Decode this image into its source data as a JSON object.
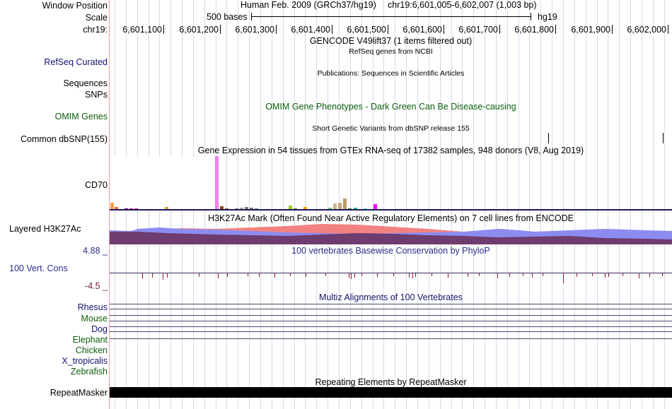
{
  "header": {
    "assembly": "Human Feb. 2009 (GRCh37/hg19)",
    "position": "chr19:6,601,005-6,602,007 (1,003 bp)",
    "scale_label": "500 bases",
    "scale_db": "hg19",
    "chrom_label": "chr19:",
    "ticks": [
      "6,601,100",
      "6,601,200",
      "6,601,300",
      "6,601,400",
      "6,601,500",
      "6,601,600",
      "6,601,700",
      "6,601,800",
      "6,601,900",
      "6,602,000"
    ]
  },
  "labels": {
    "window_position": "Window Position",
    "scale": "Scale",
    "refseq": "RefSeq Curated",
    "sequences": "Sequences",
    "snps": "SNPs",
    "omim": "OMIM Genes",
    "dbsnp": "Common dbSNP(155)",
    "cd70": "CD70",
    "h3k27ac": "Layered H3K27Ac",
    "cons_max": "4.88 _",
    "cons": "100 Vert. Cons",
    "cons_min": "-4.5 _",
    "species": [
      "Rhesus",
      "Mouse",
      "Dog",
      "Elephant",
      "Chicken",
      "X_tropicalis",
      "Zebrafish"
    ],
    "repeatmasker": "RepeatMasker"
  },
  "tracks": {
    "gencode": "GENCODE V49lift37 (1 items filtered out)",
    "refseq": "RefSeq genes from NCBI",
    "publications": "Publications: Sequences in Scientific Articles",
    "omim": "OMIM Gene Phenotypes - Dark Green Can Be Disease-causing",
    "dbsnp": "Short Genetic Variants from dbSNP release 155",
    "gtex": "Gene Expression in 54 tissues from GTEx RNA-seq of 17382 samples, 948 donors (V8, Aug 2019)",
    "h3k27ac": "H3K27Ac Mark (Often Found Near Active Regulatory Elements) on 7 cell lines from ENCODE",
    "phylop": "100 vertebrates Basewise Conservation by PhyloP",
    "multiz": "Multiz Alignments of 100 Vertebrates",
    "rmsk": "Repeating Elements by RepeatMasker"
  },
  "colors": {
    "navy": "#13136e",
    "green": "#0b5e0b",
    "h3k27ac_red": "#f28282",
    "h3k27ac_blue": "#8c8cf0",
    "h3k27ac_purple": "#6e3c6e",
    "phylop": "#8b1a3a",
    "gtex_peak": "#ee82ee"
  }
}
